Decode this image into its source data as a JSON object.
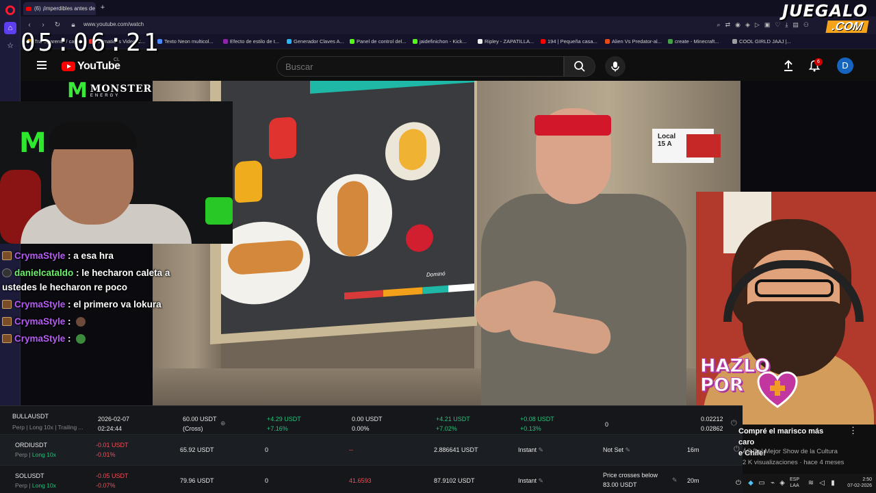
{
  "browser": {
    "tab_title": "(6) ¡Imperdibles antes de",
    "url": "www.youtube.com/watch",
    "bookmarks": [
      "Transparenta / cami...",
      "Animations Video C...",
      "Texto Neon multicol...",
      "Efecto de estilo de t...",
      "Generador Claves A...",
      "Panel de control del...",
      "jaidefinichon - Kick...",
      "Ripley - ZAPATILLA...",
      "194 | Pequeña casa...",
      "Alien Vs Predator-al...",
      "create - Minecraft...",
      "COOL GIRLD JAAJ |..."
    ],
    "icons": [
      "home-icon",
      "star-icon",
      "back-icon",
      "forward-icon",
      "reload-icon",
      "lock-icon",
      "search-icon",
      "camera-icon",
      "shield-icon",
      "heart-icon",
      "download-icon",
      "menu-icon"
    ]
  },
  "watermark": {
    "top": "JUEGALO",
    "bottom": ".COM"
  },
  "clock": "05:06:21",
  "youtube": {
    "logo": "YouTube",
    "country": "CL",
    "search_placeholder": "Buscar",
    "notifications": "6",
    "avatar_letter": "D"
  },
  "video": {
    "sign_local": "Local",
    "sign_number": "15 A",
    "poster_brand": "Dominó"
  },
  "sponsor": {
    "brand": "MONSTER",
    "sub": "ENERGY"
  },
  "chat": [
    {
      "user": "CrymaStyle",
      "user_color": "purple",
      "message": "a esa hra"
    },
    {
      "user": "danielcataldo",
      "user_color": "green",
      "message": "le hecharon caleta a ustedes le hecharon re poco"
    },
    {
      "user": "CrymaStyle",
      "user_color": "purple",
      "message": "el primero va lokura"
    },
    {
      "user": "CrymaStyle",
      "user_color": "purple",
      "message": ""
    },
    {
      "user": "CrymaStyle",
      "user_color": "purple",
      "message": ""
    }
  ],
  "overlay": {
    "line1": "HAZLO",
    "line2": "POR"
  },
  "trading": {
    "rows": [
      {
        "symbol": "BULLAUSDT",
        "detail": "Perp | Long 10x | Trailing ...",
        "date": "2026-02-07",
        "time": "02:24:44",
        "margin": "60.00 USDT",
        "margin_mode": "(Cross)",
        "pnl": "+4.29 USDT",
        "pnl_pct": "+7.16%",
        "realized": "0.00 USDT",
        "realized_pct": "0.00%",
        "roe": "+4.21 USDT",
        "roe_pct": "+7.02%",
        "fee": "+0.08 USDT",
        "fee_pct": "+0.13%",
        "qty": "0",
        "price_a": "0.02212",
        "price_b": "0.02862"
      },
      {
        "symbol": "ORDIUSDT",
        "detail_a": "Perp",
        "detail_b": "Long 10x",
        "pnl": "-0.01 USDT",
        "pnl_pct": "-0.01%",
        "value": "65.92 USDT",
        "qty": "0",
        "dash": "--",
        "price": "2.886641 USDT",
        "mode": "Instant",
        "tp": "Not Set",
        "timeframe": "16m"
      },
      {
        "symbol": "SOLUSDT",
        "detail_a": "Perp",
        "detail_b": "Long 10x",
        "pnl": "-0.05 USDT",
        "pnl_pct": "-0.07%",
        "value": "79.96 USDT",
        "qty": "0",
        "liq": "41.6593",
        "price": "87.9102 USDT",
        "mode": "Instant",
        "tp_line1": "Price crosses below",
        "tp_line2": "83.00 USDT",
        "timeframe": "20m"
      }
    ]
  },
  "suggestion": {
    "title_line1": "Compré el marisco más caro",
    "title_line2": "e Chile!",
    "channel": "ÁS Del Mejor Show de la Cultura",
    "meta": "2 K visualizaciones · hace 4 meses"
  },
  "taskbar": {
    "lang1": "ESP",
    "lang2": "LAA",
    "time": "2:50",
    "date": "07-02-2026"
  }
}
